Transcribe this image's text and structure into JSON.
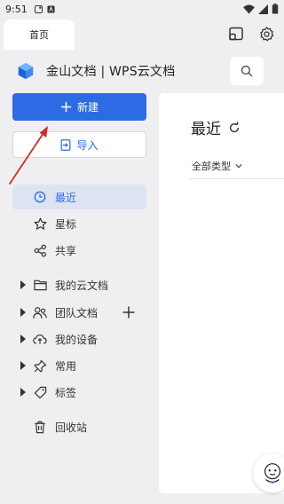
{
  "status_bar": {
    "time": "9:51"
  },
  "tab": {
    "label": "首页"
  },
  "app": {
    "title": "金山文档 | WPS云文档"
  },
  "actions": {
    "new_label": "新建",
    "import_label": "导入"
  },
  "nav": {
    "recent": "最近",
    "starred": "星标",
    "shared": "共享",
    "my_cloud": "我的云文档",
    "team_docs": "团队文档",
    "my_devices": "我的设备",
    "frequent": "常用",
    "tags": "标签",
    "trash": "回收站"
  },
  "content": {
    "title": "最近",
    "filter": "全部类型"
  },
  "colors": {
    "accent": "#2d6be4",
    "active_bg": "#dde4f1",
    "annotation": "#d22b2b"
  }
}
